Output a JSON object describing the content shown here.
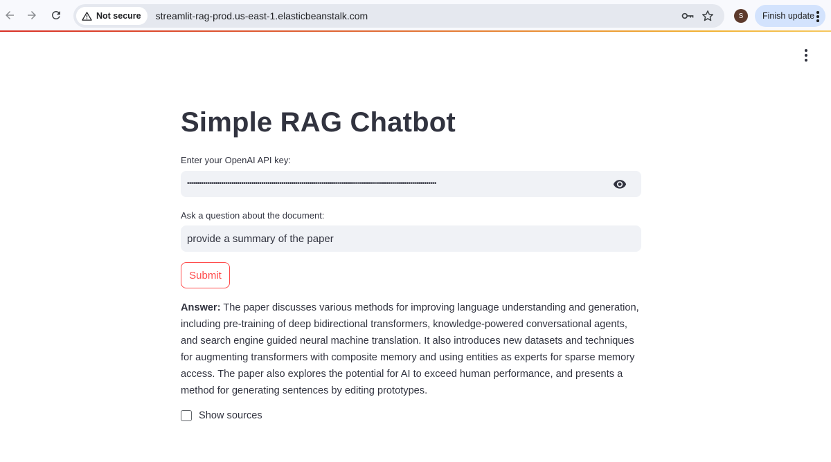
{
  "browser": {
    "security_label": "Not secure",
    "url": "streamlit-rag-prod.us-east-1.elasticbeanstalk.com",
    "profile_initial": "S",
    "finish_update_label": "Finish update"
  },
  "page": {
    "title": "Simple RAG Chatbot",
    "api_key": {
      "label": "Enter your OpenAI API key:",
      "masked_value": "••••••••••••••••••••••••••••••••••••••••••••••••••••••••••••••••••••••••••••••••••••••••••••••••••••••••••••••••••••••••••••"
    },
    "question": {
      "label": "Ask a question about the document:",
      "value": "provide a summary of the paper"
    },
    "submit_label": "Submit",
    "answer": {
      "prefix": "Answer:",
      "text": " The paper discusses various methods for improving language understanding and generation, including pre-training of deep bidirectional transformers, knowledge-powered conversational agents, and search engine guided neural machine translation. It also introduces new datasets and techniques for augmenting transformers with composite memory and using entities as experts for sparse memory access. The paper also explores the potential for AI to exceed human performance, and presents a method for generating sentences by editing prototypes."
    },
    "show_sources_label": "Show sources",
    "show_sources_checked": false
  },
  "colors": {
    "accent": "#ff4b4b",
    "text": "#31333f",
    "input_bg": "#f0f2f6"
  },
  "icons": [
    "back-arrow-icon",
    "forward-arrow-icon",
    "reload-icon",
    "warning-icon",
    "key-icon",
    "star-icon",
    "eye-icon",
    "kebab-menu-icon"
  ]
}
